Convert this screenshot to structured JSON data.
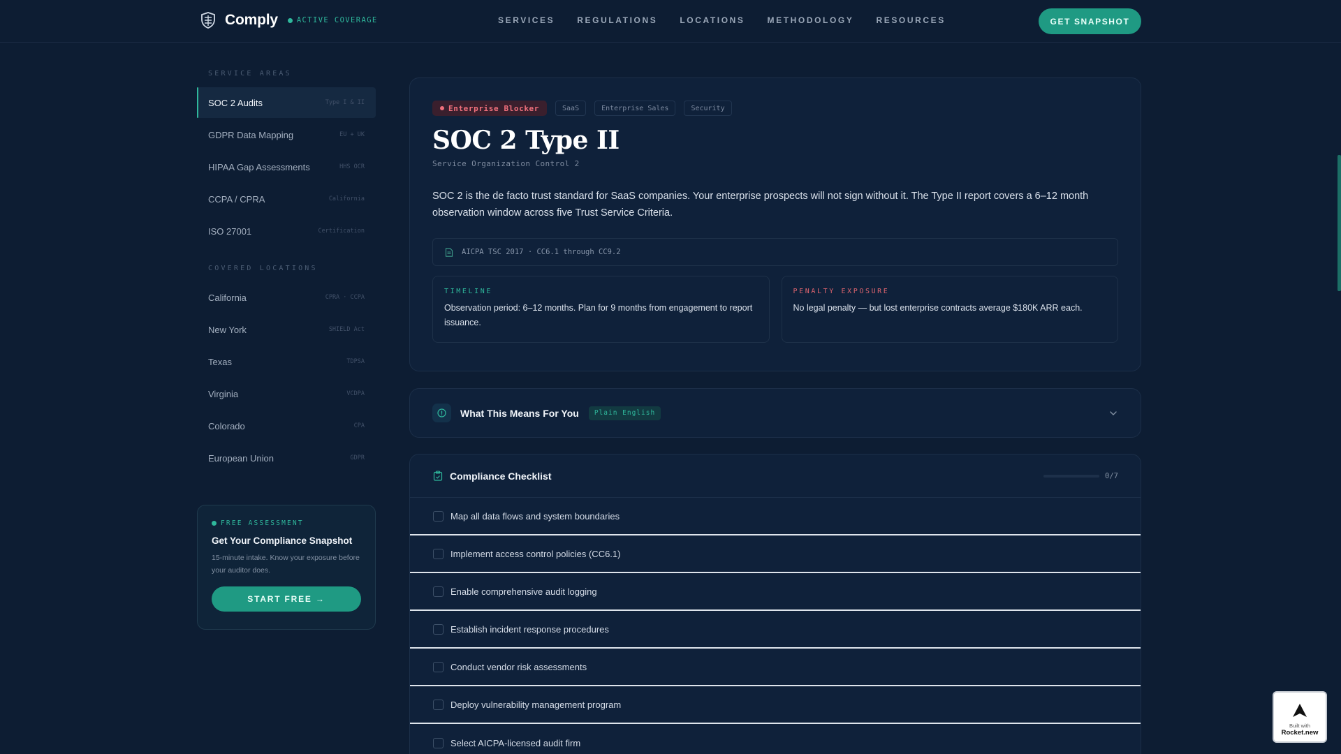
{
  "header": {
    "brand": "Comply",
    "coverage": "ACTIVE COVERAGE",
    "nav": [
      "SERVICES",
      "REGULATIONS",
      "LOCATIONS",
      "METHODOLOGY",
      "RESOURCES"
    ],
    "cta": "GET SNAPSHOT"
  },
  "sidebar": {
    "service_heading": "SERVICE AREAS",
    "services": [
      {
        "label": "SOC 2 Audits",
        "tag": "Type I & II"
      },
      {
        "label": "GDPR Data Mapping",
        "tag": "EU + UK"
      },
      {
        "label": "HIPAA Gap Assessments",
        "tag": "HHS OCR"
      },
      {
        "label": "CCPA / CPRA",
        "tag": "California"
      },
      {
        "label": "ISO 27001",
        "tag": "Certification"
      }
    ],
    "location_heading": "COVERED LOCATIONS",
    "locations": [
      {
        "label": "California",
        "tag": "CPRA · CCPA"
      },
      {
        "label": "New York",
        "tag": "SHIELD Act"
      },
      {
        "label": "Texas",
        "tag": "TDPSA"
      },
      {
        "label": "Virginia",
        "tag": "VCDPA"
      },
      {
        "label": "Colorado",
        "tag": "CPA"
      },
      {
        "label": "European Union",
        "tag": "GDPR"
      }
    ],
    "promo": {
      "tag": "FREE ASSESSMENT",
      "title": "Get Your Compliance Snapshot",
      "desc": "15-minute intake. Know your exposure before your auditor does.",
      "button": "START FREE →"
    }
  },
  "hero": {
    "badge": "Enterprise Blocker",
    "tags": [
      "SaaS",
      "Enterprise Sales",
      "Security"
    ],
    "title": "SOC 2 Type II",
    "subtitle": "Service Organization Control 2",
    "description": "SOC 2 is the de facto trust standard for SaaS companies. Your enterprise prospects will not sign without it. The Type II report covers a 6–12 month observation window across five Trust Service Criteria.",
    "reference": "AICPA TSC 2017 · CC6.1 through CC9.2",
    "timeline_label": "TIMELINE",
    "timeline_text": "Observation period: 6–12 months. Plan for 9 months from engagement to report issuance.",
    "penalty_label": "PENALTY EXPOSURE",
    "penalty_text": "No legal penalty — but lost enterprise contracts average $180K ARR each."
  },
  "accordion": {
    "title": "What This Means For You",
    "badge": "Plain English"
  },
  "checklist": {
    "title": "Compliance Checklist",
    "progress_text": "0/7",
    "progress_value": 0,
    "items": [
      "Map all data flows and system boundaries",
      "Implement access control policies (CC6.1)",
      "Enable comprehensive audit logging",
      "Establish incident response procedures",
      "Conduct vendor risk assessments",
      "Deploy vulnerability management program",
      "Select AICPA-licensed audit firm"
    ]
  },
  "badge": {
    "small": "Built with",
    "brand": "Rocket.new"
  }
}
